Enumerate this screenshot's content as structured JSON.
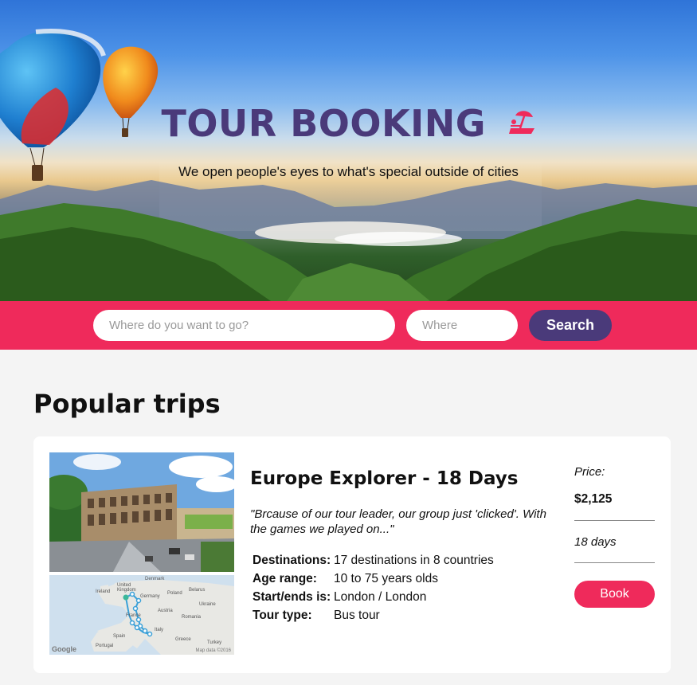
{
  "hero": {
    "title": "TOUR BOOKING",
    "subtitle": "We open people's eyes to what's special outside of cities",
    "icon": "beach-umbrella-icon"
  },
  "search": {
    "destination_placeholder": "Where do you want to go?",
    "where_placeholder": "Where",
    "button_label": "Search"
  },
  "section": {
    "title": "Popular trips"
  },
  "trip": {
    "title": "Europe Explorer - 18 Days",
    "quote": "\"Brcause of our tour leader, our group just 'clicked'. With the games we played on...\"",
    "details": [
      {
        "label": "Destinations:",
        "value": "17 destinations in 8 countries"
      },
      {
        "label": "Age range:",
        "value": "10 to 75 years olds"
      },
      {
        "label": "Start/ends is:",
        "value": "London / London"
      },
      {
        "label": "Tour type:",
        "value": "Bus tour"
      }
    ],
    "price_label": "Price:",
    "price": "$2,125",
    "duration": "18 days",
    "book_label": "Book",
    "map": {
      "labels": [
        "Denmark",
        "United Kingdom",
        "Ireland",
        "Belarus",
        "Germany",
        "Poland",
        "Ukraine",
        "France",
        "Austria",
        "Romania",
        "Italy",
        "Spain",
        "Portugal",
        "Greece",
        "Turkey"
      ],
      "google": "Google",
      "credit": "Map data ©2016"
    }
  },
  "colors": {
    "accent_pink": "#ef2a5b",
    "accent_purple": "#4a3a7a",
    "background": "#f4f4f4"
  }
}
